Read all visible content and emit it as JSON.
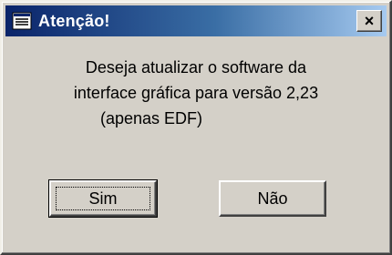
{
  "dialog": {
    "title": "Atenção!",
    "close_label": "×",
    "message_lines": [
      "Deseja atualizar o software da",
      "interface gráfica para versão 2,23",
      "(apenas EDF)"
    ],
    "buttons": {
      "yes_label": "Sim",
      "no_label": "Não"
    },
    "colors": {
      "titlebar_start": "#0a246a",
      "titlebar_end": "#a6caf0",
      "face": "#d4d0c8"
    },
    "icons": {
      "title": "app-window-icon"
    }
  }
}
